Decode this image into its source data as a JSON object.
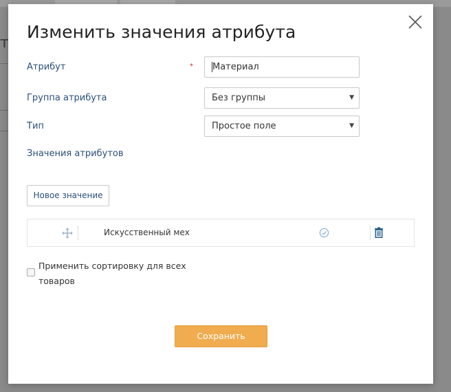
{
  "background": {
    "overlay_color": "#7a7a7a",
    "page_letter": "т"
  },
  "modal": {
    "title": "Изменить значения атрибута",
    "close_icon": "close-icon",
    "fields": {
      "attribute_label": "Атрибут",
      "required_marker": "*",
      "attribute_value": "Материал",
      "group_label": "Группа атрибута",
      "group_selected": "Без группы",
      "type_label": "Тип",
      "type_selected": "Простое поле",
      "values_label": "Значения атрибутов"
    },
    "new_value_button": "Новое значение",
    "values": [
      {
        "text": "Искусственный мех",
        "icons": [
          "drag-icon",
          "check-circle-icon",
          "trash-icon"
        ]
      }
    ],
    "apply_sort_label": "Применить сортировку для всех товаров",
    "apply_sort_checked": false,
    "save_button": "Сохранить"
  },
  "colors": {
    "label": "#2b4f7a",
    "required": "#d0312d",
    "save_button": "#f0ac4f",
    "check_icon": "#8ab4d9",
    "trash_icon": "#1f5b8c"
  }
}
